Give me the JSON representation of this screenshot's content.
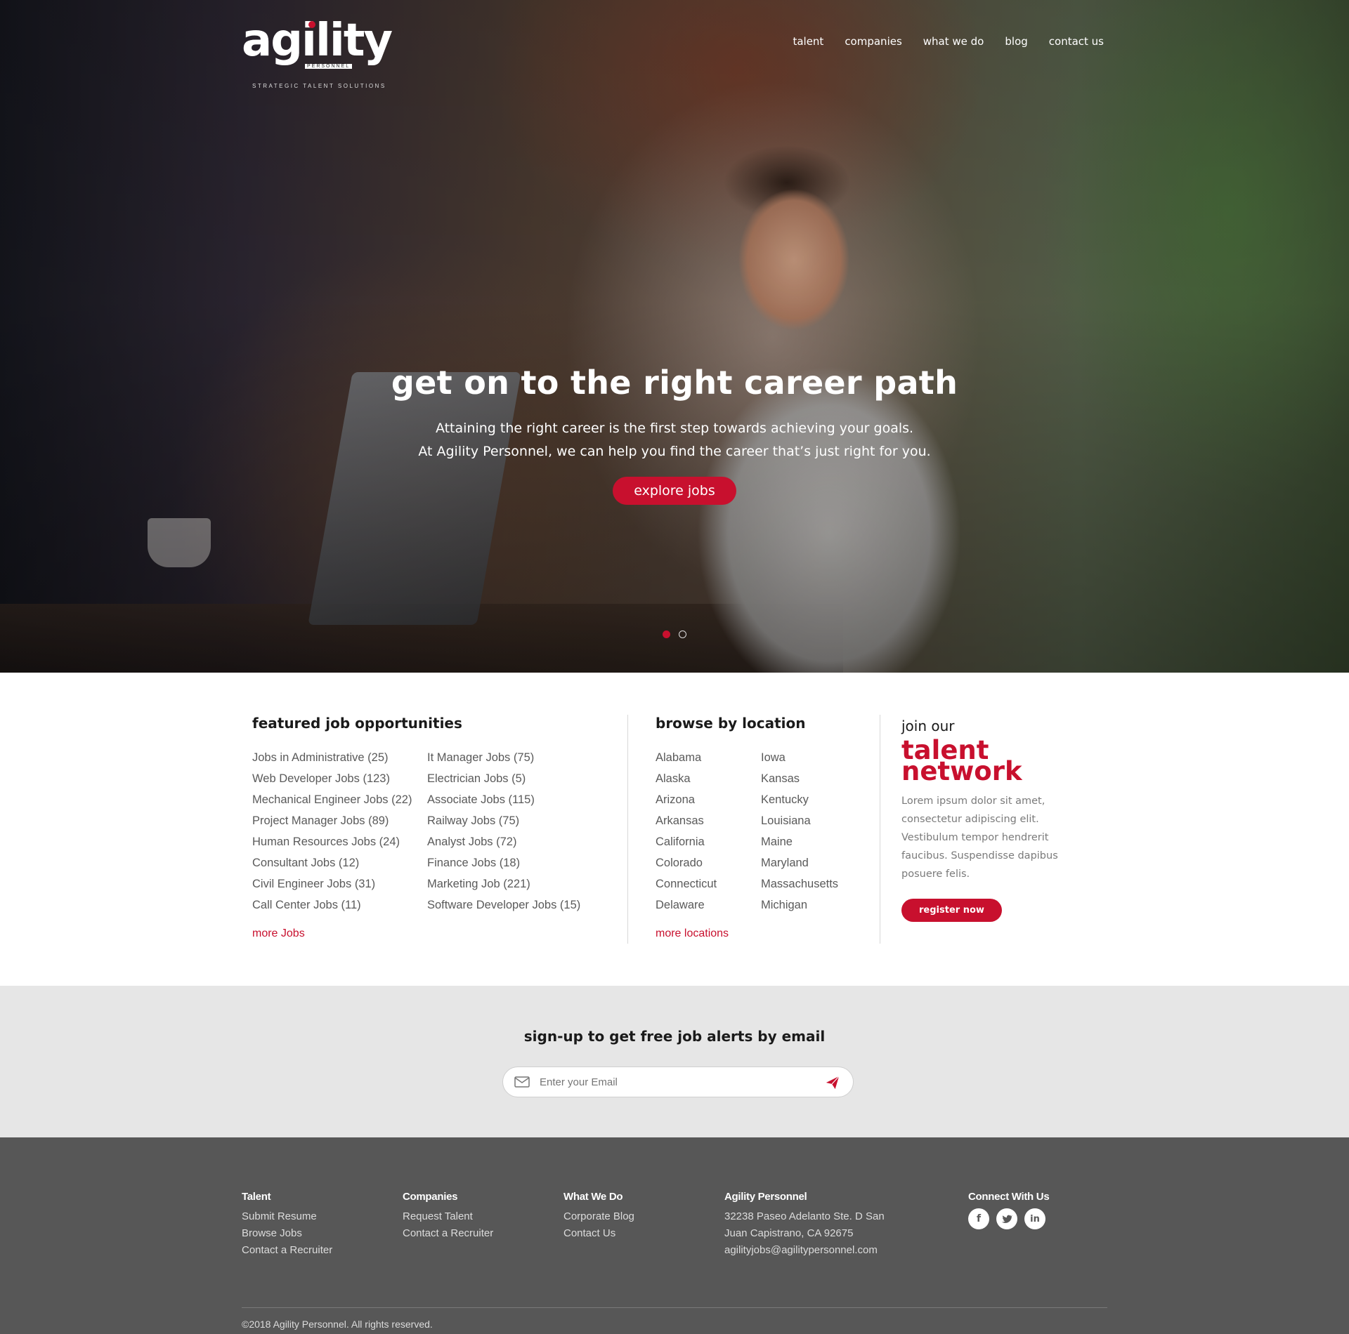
{
  "brand": {
    "logo_text": "agility",
    "logo_sub": "PERSONNEL",
    "tagline": "STRATEGIC TALENT SOLUTIONS",
    "accent": "#c8102e"
  },
  "nav": [
    {
      "label": "talent"
    },
    {
      "label": "companies"
    },
    {
      "label": "what we do"
    },
    {
      "label": "blog"
    },
    {
      "label": "contact us"
    }
  ],
  "hero": {
    "title": "get on to the right career path",
    "line1": "Attaining the right career is the first step towards achieving your goals.",
    "line2": "At Agility Personnel, we can help you find the career that’s just right for you.",
    "button": "explore jobs",
    "slides": 2,
    "active_slide": 1
  },
  "featured": {
    "title": "featured job opportunities",
    "col1": [
      "Jobs in Administrative (25)",
      "Web Developer Jobs (123)",
      "Mechanical Engineer Jobs (22)",
      "Project Manager Jobs (89)",
      "Human Resources Jobs (24)",
      "Consultant Jobs (12)",
      "Civil Engineer Jobs (31)",
      "Call Center Jobs (11)"
    ],
    "col2": [
      "It Manager Jobs (75)",
      "Electrician Jobs (5)",
      "Associate Jobs (115)",
      "Railway Jobs (75)",
      "Analyst Jobs (72)",
      "Finance Jobs (18)",
      "Marketing Job (221)",
      "Software Developer Jobs (15)"
    ],
    "more": "more Jobs"
  },
  "location": {
    "title": "browse by location",
    "col1": [
      "Alabama",
      "Alaska",
      "Arizona",
      "Arkansas",
      "California",
      "Colorado",
      "Connecticut",
      "Delaware"
    ],
    "col2": [
      "Iowa",
      "Kansas",
      "Kentucky",
      "Louisiana",
      "Maine",
      "Maryland",
      "Massachusetts",
      "Michigan"
    ],
    "more": "more locations"
  },
  "network": {
    "join": "join our",
    "line1": "talent",
    "line2": "network",
    "body": "Lorem ipsum dolor sit amet, consectetur adipiscing elit. Vestibulum tempor hendrerit faucibus. Suspendisse dapibus posuere felis.",
    "button": "register now"
  },
  "alerts": {
    "title": "sign-up to get free job alerts by email",
    "placeholder": "Enter your Email",
    "mail_icon": "mail-icon",
    "send_icon": "paper-plane-icon"
  },
  "footer": {
    "talent": {
      "title": "Talent",
      "links": [
        "Submit Resume",
        "Browse Jobs",
        "Contact a Recruiter"
      ]
    },
    "companies": {
      "title": "Companies",
      "links": [
        "Request Talent",
        "Contact a Recruiter"
      ]
    },
    "whatwedo": {
      "title": "What We Do",
      "links": [
        "Corporate Blog",
        "Contact Us"
      ]
    },
    "agility": {
      "title": "Agility Personnel",
      "lines": [
        "32238 Paseo Adelanto Ste. D San",
        "Juan Capistrano, CA 92675",
        "agilityjobs@agilitypersonnel.com"
      ]
    },
    "connect": {
      "title": "Connect With Us",
      "icons": [
        "facebook-icon",
        "twitter-icon",
        "linkedin-icon"
      ]
    },
    "copyright": "©2018 Agility Personnel. All rights reserved."
  }
}
